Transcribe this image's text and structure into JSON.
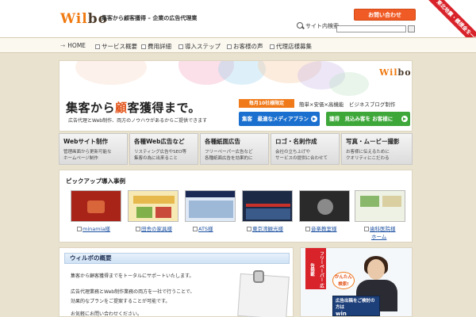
{
  "header": {
    "logo_a": "Wil",
    "logo_b": "bo",
    "tagline": "集客から顧客獲得 – 企業の広告代理業",
    "contact_button": "お問い合わせ",
    "search_label": "サイト内検索",
    "search_placeholder": "",
    "search_button": "",
    "ribbon": "東北地震・義援金を一緒に"
  },
  "nav": {
    "items": [
      {
        "label": "HOME"
      },
      {
        "label": "サービス概要"
      },
      {
        "label": "費用詳細"
      },
      {
        "label": "導入ステップ"
      },
      {
        "label": "お客様の声"
      },
      {
        "label": "代理店様募集"
      }
    ]
  },
  "hero": {
    "logo_a": "Wil",
    "logo_b": "bo",
    "title_a": "集客から",
    "title_accent": "顧",
    "title_b": "客獲得まで。",
    "subtitle": "広告代理とWeb制作、両方のノウハウがあるからご提供できます",
    "badge": "毎月10社様限定",
    "badge_text": "簡単×安価×高機能　ビジネスブログ制作",
    "cta_blue": "集客　最適なメディアプラン",
    "cta_green": "獲得　見込み客を お客様に"
  },
  "services": [
    {
      "title": "Webサイト制作",
      "desc1": "管理画面から更新可能な",
      "desc2": "ホームページ制作"
    },
    {
      "title": "各種Web広告など",
      "desc1": "リスティング広告やSEO等",
      "desc2": "集客の為に出来ること"
    },
    {
      "title": "各種紙面広告",
      "desc1": "フリーペーパー広告など",
      "desc2": "各種紙面広告を効果的に"
    },
    {
      "title": "ロゴ・名刺作成",
      "desc1": "会社の立ち上げや",
      "desc2": "サービスの提供に合わせて"
    },
    {
      "title": "写真・ムービー撮影",
      "desc1": "お客様に伝えるために",
      "desc2": "クオリティにこだわる"
    }
  ],
  "pickup": {
    "title": "ピックアップ導入事例",
    "items": [
      {
        "label": "minamia様"
      },
      {
        "label": "田舎の家具様"
      },
      {
        "label": "ATS様"
      },
      {
        "label": "東京湾観光様"
      },
      {
        "label": "音楽教室様"
      },
      {
        "label": "歯科医院様",
        "label2": "ホーム"
      }
    ]
  },
  "overview": {
    "title": "ウィルボの概要",
    "lines": [
      "集客から顧客獲得までをトータルにサポートいたします。",
      "広告代理業務とWeb制作業務の両方を一社で行うことで、",
      "効果的なプランをご提案することが可能です。",
      "お気軽にお問い合わせください。"
    ]
  },
  "ad": {
    "ribbon": "フリーペーパー 広告掲載",
    "bubble": "かんたん 検索!",
    "card_line1": "広告出稿をご検討の方は",
    "card_win": "win"
  },
  "colors": {
    "accent_orange": "#f07a1a",
    "brand_red": "#d8232a",
    "cta_blue": "#1a6fcf",
    "cta_green": "#3ea73a",
    "page_bg": "#e9e2cf"
  }
}
